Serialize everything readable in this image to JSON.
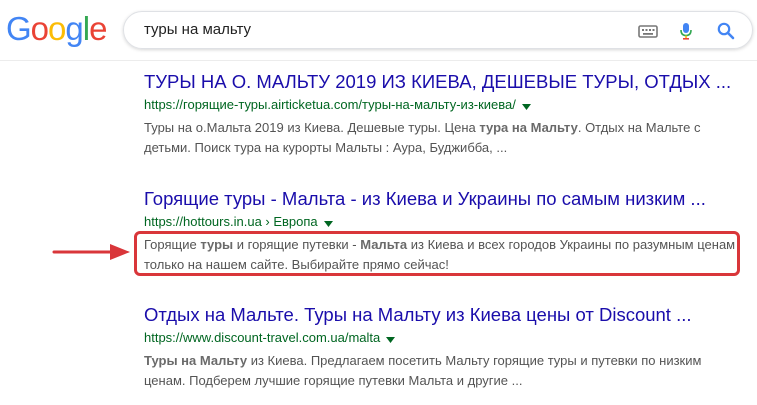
{
  "logo": {
    "letters": [
      {
        "ch": "G",
        "color": "#4285F4"
      },
      {
        "ch": "o",
        "color": "#EA4335"
      },
      {
        "ch": "o",
        "color": "#FBBC05"
      },
      {
        "ch": "g",
        "color": "#4285F4"
      },
      {
        "ch": "l",
        "color": "#34A853"
      },
      {
        "ch": "e",
        "color": "#EA4335"
      }
    ]
  },
  "search": {
    "query": "туры на мальту",
    "icons": [
      "keyboard-icon",
      "microphone-icon",
      "search-icon"
    ]
  },
  "results": [
    {
      "title": "ТУРЫ НА О. МАЛЬТУ 2019 ИЗ КИЕВА, ДЕШЕВЫЕ ТУРЫ, ОТДЫХ ...",
      "url": "https://горящие-туры.airticketua.com/туры-на-мальту-из-киева/",
      "snippet": [
        [
          {
            "t": "Туры на о.Мальта 2019 из Киева. Дешевые туры. Цена ",
            "b": false
          },
          {
            "t": "тура на Мальту",
            "b": true
          },
          {
            "t": ". Отдых на Мальте с",
            "b": false
          }
        ],
        [
          {
            "t": "детьми. Поиск тура на курорты Мальты : Аура, Буджибба, ...",
            "b": false
          }
        ]
      ]
    },
    {
      "title": "Горящие туры - Мальта - из Киева и Украины по самым низким ...",
      "url": "https://hottours.in.ua › Европа",
      "snippet": [
        [
          {
            "t": "Горящие ",
            "b": false
          },
          {
            "t": "туры",
            "b": true
          },
          {
            "t": " и горящие путевки - ",
            "b": false
          },
          {
            "t": "Мальта",
            "b": true
          },
          {
            "t": " из Киева и всех городов Украины по разумным ценам",
            "b": false
          }
        ],
        [
          {
            "t": "только на нашем сайте. Выбирайте прямо сейчас!",
            "b": false
          }
        ]
      ]
    },
    {
      "title": "Отдых на Мальте. Туры на Мальту из Киева цены от Discount ...",
      "url": "https://www.discount-travel.com.ua/malta",
      "snippet": [
        [
          {
            "t": "Туры на Мальту",
            "b": true
          },
          {
            "t": " из Киева. Предлагаем посетить Мальту горящие туры и путевки по низким",
            "b": false
          }
        ],
        [
          {
            "t": "ценам. Подберем лучшие горящие путевки Мальта и другие ",
            "b": false
          },
          {
            "t": "...",
            "b": false
          }
        ]
      ]
    }
  ],
  "colors": {
    "title_link": "#1a0dab",
    "url_green": "#006621",
    "snippet_gray": "#545454",
    "highlight_red": "#d9363a"
  }
}
